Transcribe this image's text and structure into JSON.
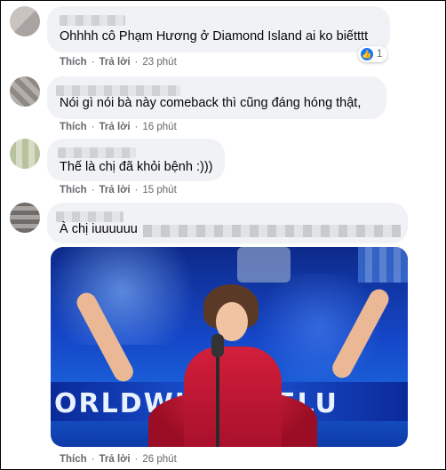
{
  "comments": [
    {
      "text": "Ohhhh cô Phạm Hương ở Diamond Island ai ko biếtttt",
      "like_label": "Thích",
      "reply_label": "Trả lời",
      "time": "23 phút",
      "reaction_count": "1"
    },
    {
      "text": "Nói gì nói bà này comeback thì cũng đáng hóng thật,",
      "like_label": "Thích",
      "reply_label": "Trả lời",
      "time": "16 phút"
    },
    {
      "text": "Thế là chị đã khỏi bệnh :)))",
      "like_label": "Thích",
      "reply_label": "Trả lời",
      "time": "15 phút"
    },
    {
      "text": "À chị iuuuuuu",
      "like_label": "Thích",
      "reply_label": "Trả lời",
      "time": "26 phút",
      "photo_caption": "ORLDWIDE INFLU"
    }
  ],
  "colors": {
    "like_blue": "#1877f2",
    "bubble_bg": "#f0f2f5",
    "meta_gray": "#65676b"
  }
}
